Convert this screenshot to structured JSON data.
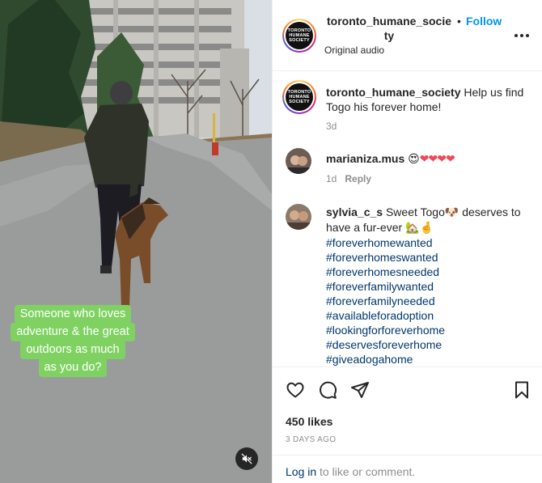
{
  "media": {
    "caption_lines": [
      "Someone who loves",
      "adventure & the great",
      "outdoors as much",
      "as you do?"
    ],
    "caption_color": "#7fd262",
    "mute_icon": "speaker-muted-icon"
  },
  "header": {
    "username_line1": "toronto_humane_socie",
    "username_line2": "ty",
    "separator": "•",
    "follow_label": "Follow",
    "audio_label": "Original audio",
    "avatar_text": [
      "TORONTO",
      "HUMANE",
      "SOCIETY"
    ]
  },
  "caption": {
    "username": "toronto_humane_society",
    "text": " Help us find Togo his forever home!",
    "time": "3d"
  },
  "comments": [
    {
      "username": "marianiza.mus",
      "emoji_prefix": "😍",
      "hearts": "❤❤❤❤",
      "time": "1d",
      "reply_label": "Reply"
    },
    {
      "username": "sylvia_c_s",
      "text_a": " Sweet Togo",
      "emoji_a": "🐶",
      "text_b": " deserves to have a fur-ever ",
      "emoji_b": "🏡🤞",
      "hashtags": [
        "#foreverhomewanted",
        "#foreverhomeswanted",
        "#foreverhomesneeded",
        "#foreverfamilywanted",
        "#foreverfamilyneeded",
        "#availableforadoption",
        "#lookingforforeverhome",
        "#deservesforeverhome",
        "#giveadogahome"
      ]
    }
  ],
  "actions": {
    "likes": "450 likes",
    "date": "3 DAYS AGO",
    "login_link": "Log in",
    "login_rest": " to like or comment.",
    "icons": [
      "heart-icon",
      "comment-icon",
      "share-icon",
      "bookmark-icon"
    ]
  },
  "colors": {
    "follow": "#0095f6",
    "link": "#00376b",
    "muted_text": "#8e8e8e",
    "divider": "#efefef"
  }
}
